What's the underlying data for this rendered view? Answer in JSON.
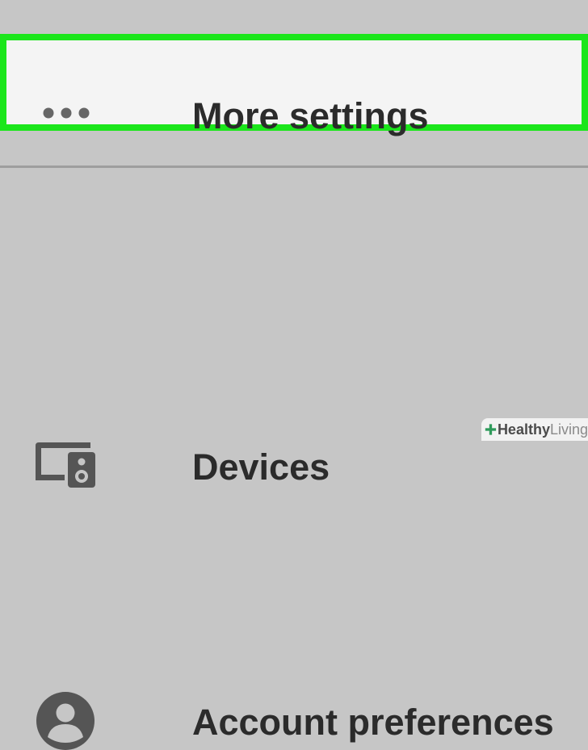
{
  "menu": {
    "items": [
      {
        "label": "More settings",
        "icon": "more-horizontal-icon",
        "highlighted": true
      },
      {
        "label": "Devices",
        "icon": "devices-speaker-icon",
        "highlighted": false
      },
      {
        "label": "Account preferences",
        "icon": "account-circle-icon",
        "highlighted": false
      }
    ]
  },
  "watermark": {
    "brand_bold": "Healthy",
    "brand_light": "Living"
  },
  "colors": {
    "background": "#c6c6c6",
    "highlight_border": "#1be61b",
    "highlight_fill": "#f4f4f4",
    "text": "#2b2b2b",
    "icon": "#555555",
    "divider": "#9e9e9e",
    "watermark_accent": "#2e9a5a"
  }
}
